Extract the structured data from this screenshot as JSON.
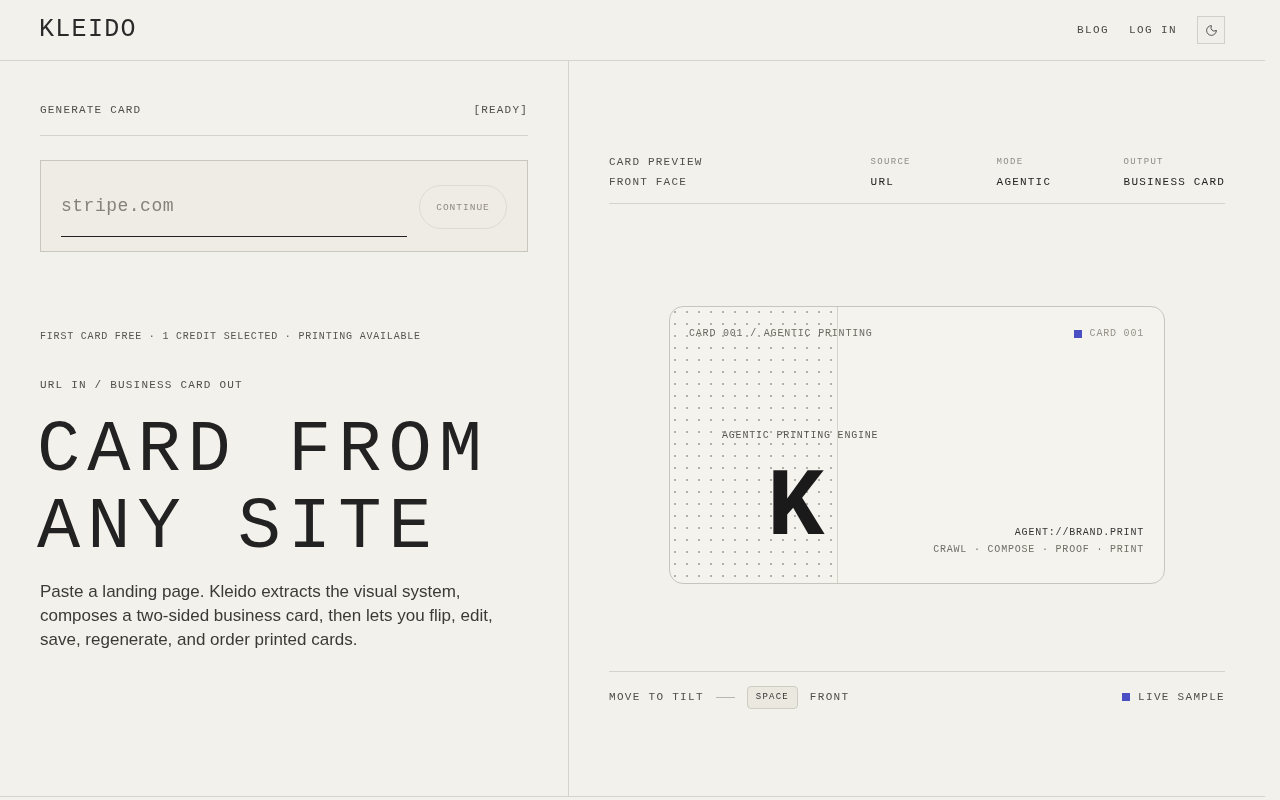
{
  "header": {
    "logo": "KLEIDO",
    "nav": [
      "BLOG",
      "LOG IN"
    ]
  },
  "generator": {
    "title": "GENERATE CARD",
    "status": "[READY]",
    "input": {
      "placeholder": "stripe.com"
    },
    "continue_button": {
      "label": "CONTINUE",
      "disabled": true
    }
  },
  "info_line": "FIRST CARD FREE · 1 CREDIT SELECTED · PRINTING AVAILABLE",
  "eyebrow": "URL IN / BUSINESS CARD OUT",
  "headline": "CARD FROM ANY SITE",
  "description": "Paste a landing page. Kleido extracts the visual system, composes a two-sided business card, then lets you flip, edit, save, regenerate, and order printed cards.",
  "preview": {
    "title": "CARD PREVIEW",
    "face": "FRONT FACE",
    "meta": [
      {
        "label": "SOURCE",
        "value": "URL"
      },
      {
        "label": "MODE",
        "value": "AGENTIC"
      },
      {
        "label": "OUTPUT",
        "value": "BUSINESS CARD"
      }
    ],
    "card": {
      "series": "CARD 001 / AGENTIC PRINTING",
      "badge": "CARD 001",
      "tagline": "AGENTIC PRINTING ENGINE",
      "monogram": "K",
      "handle": "AGENT://BRAND.PRINT",
      "steps": "CRAWL · COMPOSE · PROOF · PRINT"
    },
    "footer": {
      "hint": "MOVE TO TILT",
      "key": "SPACE",
      "side": "FRONT",
      "live": "LIVE SAMPLE"
    }
  }
}
